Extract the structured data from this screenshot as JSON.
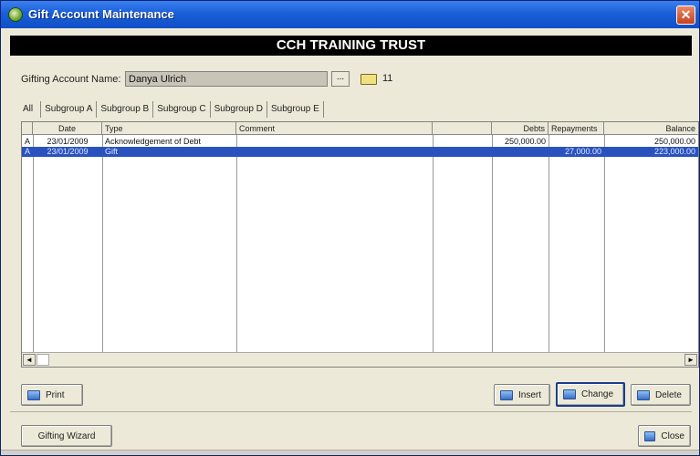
{
  "window": {
    "title": "Gift Account Maintenance",
    "close_glyph": "✕"
  },
  "banner": {
    "title": "CCH TRAINING TRUST"
  },
  "account": {
    "label": "Gifting Account Name:",
    "value": "Danya Ulrich",
    "browse_label": "...",
    "count": "11"
  },
  "tabs": [
    "All",
    "Subgroup A",
    "Subgroup B",
    "Subgroup C",
    "Subgroup D",
    "Subgroup E"
  ],
  "grid": {
    "headers": [
      "",
      "Date",
      "Type",
      "Comment",
      "",
      "Debts",
      "Repayments",
      "Balance"
    ],
    "rows": [
      {
        "flag": "A",
        "date": "23/01/2009",
        "type": "Acknowledgement of Debt",
        "comment": "",
        "extra": "",
        "debts": "250,000.00",
        "repayments": "",
        "balance": "250,000.00",
        "selected": false
      },
      {
        "flag": "A",
        "date": "23/01/2009",
        "type": "Gift",
        "comment": "",
        "extra": "",
        "debts": "",
        "repayments": "27,000.00",
        "balance": "223,000.00",
        "selected": true
      }
    ],
    "scroll_left": "◄",
    "scroll_right": "►"
  },
  "buttons": {
    "print": "Print",
    "insert": "Insert",
    "change": "Change",
    "delete": "Delete",
    "wizard": "Gifting Wizard",
    "close": "Close"
  },
  "icons": {
    "app": "app-icon",
    "folder": "folder-icon",
    "button": "document-icon"
  },
  "colors": {
    "title_bar": "#1b5fd8",
    "selection": "#2a52be",
    "banner": "#000000"
  }
}
